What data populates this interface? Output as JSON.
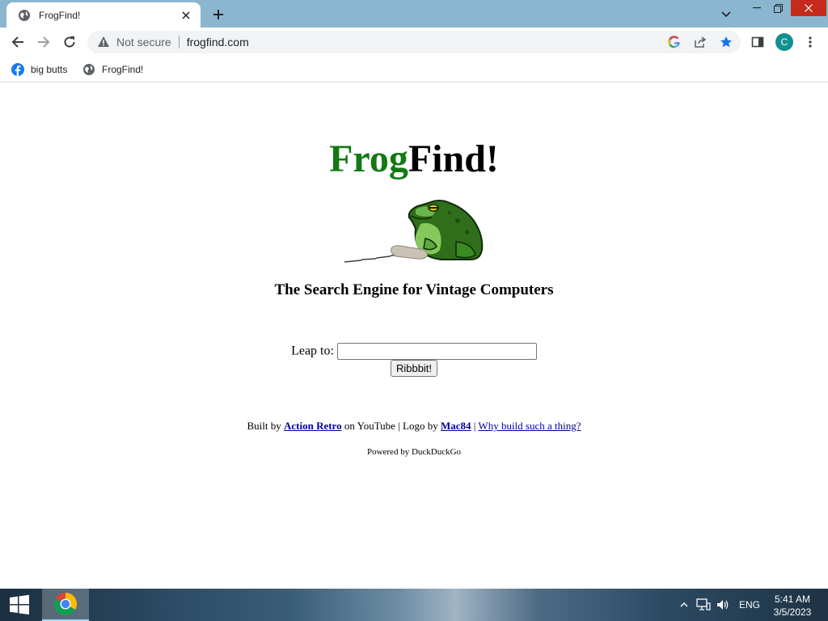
{
  "browser": {
    "tab": {
      "title": "FrogFind!"
    },
    "address_bar": {
      "security_label": "Not secure",
      "url": "frogfind.com"
    },
    "profile_initial": "C",
    "bookmarks": [
      {
        "label": "big butts",
        "icon": "facebook-icon"
      },
      {
        "label": "FrogFind!",
        "icon": "globe-icon"
      }
    ]
  },
  "page": {
    "logo": {
      "part1": "Frog",
      "part2": "Find!",
      "part1_color": "#127a12"
    },
    "tagline": "The Search Engine for Vintage Computers",
    "search": {
      "label": "Leap to:",
      "value": "",
      "button_label": "Ribbbit!"
    },
    "credits": {
      "built_by_prefix": "Built by",
      "built_by_link": "Action Retro",
      "on_youtube": "on YouTube | Logo by",
      "logo_link": "Mac84",
      "pipe": "|",
      "why_link": "Why build such a thing?"
    },
    "powered_by": "Powered by DuckDuckGo"
  },
  "taskbar": {
    "language": "ENG",
    "time": "5:41 AM",
    "date": "3/5/2023"
  }
}
